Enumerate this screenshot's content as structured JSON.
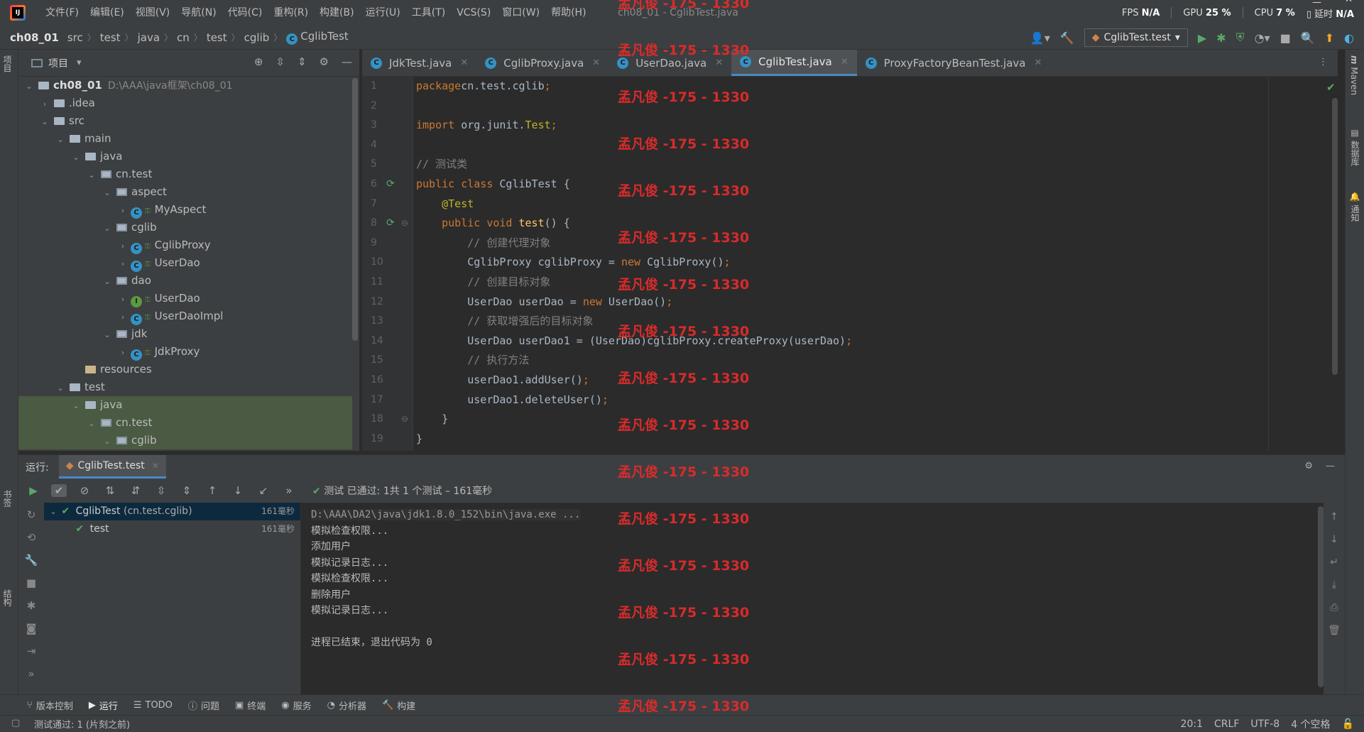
{
  "menubar": {
    "items": [
      "文件(F)",
      "编辑(E)",
      "视图(V)",
      "导航(N)",
      "代码(C)",
      "重构(R)",
      "构建(B)",
      "运行(U)",
      "工具(T)",
      "VCS(S)",
      "窗口(W)",
      "帮助(H)"
    ],
    "window_title": "ch08_01 - CglibTest.java",
    "fps_label": "FPS",
    "fps_value": "N/A",
    "gpu_label": "GPU",
    "gpu_value": "25 %",
    "cpu_label": "CPU",
    "cpu_value": "7 %",
    "delay_label": "延时",
    "delay_value": "N/A"
  },
  "breadcrumb": [
    "ch08_01",
    "src",
    "test",
    "java",
    "cn",
    "test",
    "cglib",
    "CglibTest"
  ],
  "run_config": "CglibTest.test",
  "left_strip": {
    "project_tab": "项目",
    "bookmarks_tab": "书签",
    "structure_tab": "结构"
  },
  "right_strip": {
    "maven_tab": "Maven",
    "database_tab": "数据库",
    "notify_tab": "通知"
  },
  "project_panel": {
    "title": "项目",
    "tree": [
      {
        "label": "ch08_01",
        "path": "D:\\AAA\\java框架\\ch08_01",
        "level": 0,
        "expanded": true,
        "type": "module"
      },
      {
        "label": ".idea",
        "level": 1,
        "expanded": false,
        "type": "folder"
      },
      {
        "label": "src",
        "level": 1,
        "expanded": true,
        "type": "folder"
      },
      {
        "label": "main",
        "level": 2,
        "expanded": true,
        "type": "folder"
      },
      {
        "label": "java",
        "level": 3,
        "expanded": true,
        "type": "folder"
      },
      {
        "label": "cn.test",
        "level": 4,
        "expanded": true,
        "type": "package"
      },
      {
        "label": "aspect",
        "level": 5,
        "expanded": true,
        "type": "package"
      },
      {
        "label": "MyAspect",
        "level": 6,
        "expanded": false,
        "type": "class"
      },
      {
        "label": "cglib",
        "level": 5,
        "expanded": true,
        "type": "package"
      },
      {
        "label": "CglibProxy",
        "level": 6,
        "expanded": false,
        "type": "class"
      },
      {
        "label": "UserDao",
        "level": 6,
        "expanded": false,
        "type": "class"
      },
      {
        "label": "dao",
        "level": 5,
        "expanded": true,
        "type": "package"
      },
      {
        "label": "UserDao",
        "level": 6,
        "expanded": false,
        "type": "interface"
      },
      {
        "label": "UserDaoImpl",
        "level": 6,
        "expanded": false,
        "type": "class"
      },
      {
        "label": "jdk",
        "level": 5,
        "expanded": true,
        "type": "package"
      },
      {
        "label": "JdkProxy",
        "level": 6,
        "expanded": false,
        "type": "class"
      },
      {
        "label": "resources",
        "level": 3,
        "expanded": null,
        "type": "resources"
      },
      {
        "label": "test",
        "level": 2,
        "expanded": true,
        "type": "folder"
      },
      {
        "label": "java",
        "level": 3,
        "expanded": true,
        "type": "folder",
        "selected": true
      },
      {
        "label": "cn.test",
        "level": 4,
        "expanded": true,
        "type": "package",
        "selected": true
      },
      {
        "label": "cglib",
        "level": 5,
        "expanded": true,
        "type": "package",
        "selected": true
      }
    ]
  },
  "editor": {
    "tabs": [
      {
        "label": "JdkTest.java",
        "active": false
      },
      {
        "label": "CglibProxy.java",
        "active": false
      },
      {
        "label": "UserDao.java",
        "active": false
      },
      {
        "label": "CglibTest.java",
        "active": true
      },
      {
        "label": "ProxyFactoryBeanTest.java",
        "active": false
      }
    ],
    "line_numbers": [
      "1",
      "2",
      "3",
      "4",
      "5",
      "6",
      "7",
      "8",
      "9",
      "10",
      "11",
      "12",
      "13",
      "14",
      "15",
      "16",
      "17",
      "18",
      "19"
    ]
  },
  "run_panel": {
    "label": "运行:",
    "tab": "CglibTest.test",
    "status_prefix": "测试 已通过:",
    "status_count": "1",
    "status_detail": "共 1 个测试 – 161毫秒",
    "tests": [
      {
        "name": "CglibTest",
        "package": "(cn.test.cglib)",
        "duration": "161毫秒"
      },
      {
        "name": "test",
        "duration": "161毫秒"
      }
    ],
    "console": [
      "D:\\AAA\\DA2\\java\\jdk1.8.0_152\\bin\\java.exe ...",
      "模拟检查权限...",
      "添加用户",
      "模拟记录日志...",
      "模拟检查权限...",
      "删除用户",
      "模拟记录日志...",
      "",
      "进程已结束，退出代码为 0"
    ]
  },
  "bottom_tabs": [
    "版本控制",
    "运行",
    "TODO",
    "问题",
    "终端",
    "服务",
    "分析器",
    "构建"
  ],
  "status_bar": {
    "message": "测试通过: 1 (片刻之前)",
    "position": "20:1",
    "line_sep": "CRLF",
    "encoding": "UTF-8",
    "indent": "4 个空格"
  },
  "watermark": "孟凡俊 -175 - 1330",
  "colors": {
    "keyword": "#cc7832",
    "annotation": "#bbb529",
    "comment": "#808080",
    "method": "#ffc66d",
    "pass": "#59a869",
    "accent": "#4a88c7",
    "watermark": "#e12b2b"
  }
}
